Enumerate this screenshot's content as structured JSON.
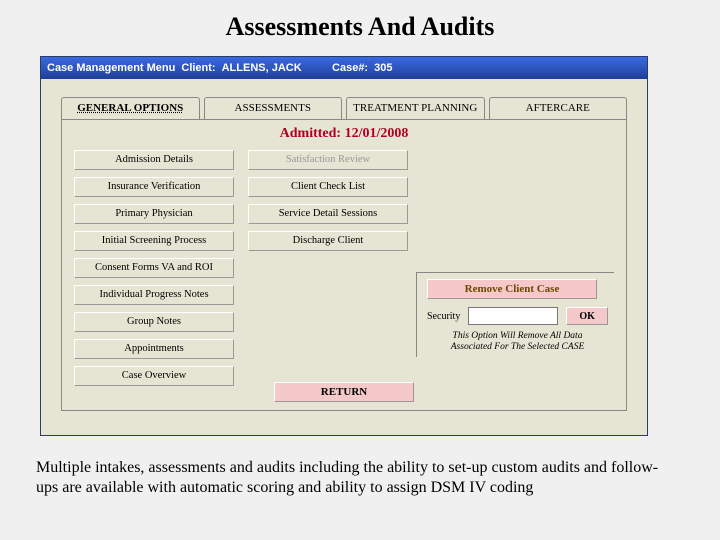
{
  "slide": {
    "title": "Assessments And Audits"
  },
  "titlebar": {
    "menu": "Case Management Menu",
    "client_label": "Client:",
    "client_name": "ALLENS, JACK",
    "case_label": "Case#:",
    "case_no": "305"
  },
  "tabs": [
    "GENERAL OPTIONS",
    "ASSESSMENTS",
    "TREATMENT PLANNING",
    "AFTERCARE"
  ],
  "admitted": {
    "label": "Admitted:",
    "date": "12/01/2008"
  },
  "col1": [
    "Admission Details",
    "Insurance Verification",
    "Primary Physician",
    "Initial Screening Process",
    "Consent Forms VA and ROI",
    "Individual Progress Notes",
    "Group Notes",
    "Appointments",
    "Case Overview"
  ],
  "col2": [
    "Satisfaction Review",
    "Client Check List",
    "Service Detail Sessions",
    "Discharge Client"
  ],
  "removebox": {
    "button": "Remove Client Case",
    "sec_label": "Security",
    "sec_value": "",
    "ok": "OK",
    "warn1": "This Option Will Remove All Data",
    "warn2": "Associated For The Selected CASE"
  },
  "return_btn": "RETURN",
  "caption": "Multiple intakes, assessments and audits including the ability to set-up custom audits and follow-ups are available with automatic scoring and ability to assign DSM IV coding"
}
